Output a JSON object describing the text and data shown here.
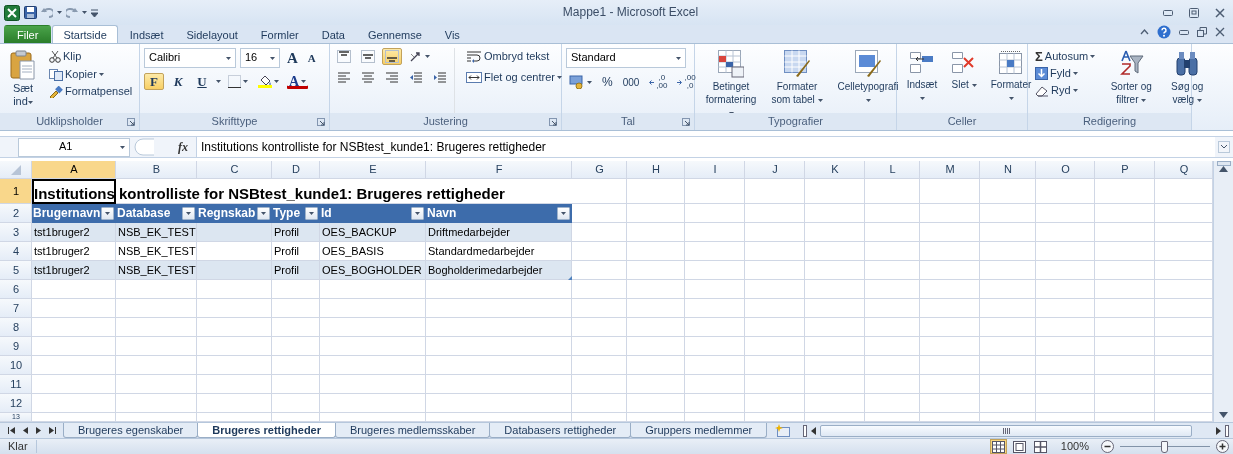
{
  "window": {
    "title": "Mappe1 - Microsoft Excel"
  },
  "ribbon_tabs": [
    {
      "label": "Filer",
      "kind": "file",
      "selected": false
    },
    {
      "label": "Startside",
      "kind": "tab",
      "selected": true
    },
    {
      "label": "Indsæt",
      "kind": "tab",
      "selected": false
    },
    {
      "label": "Sidelayout",
      "kind": "tab",
      "selected": false
    },
    {
      "label": "Formler",
      "kind": "tab",
      "selected": false
    },
    {
      "label": "Data",
      "kind": "tab",
      "selected": false
    },
    {
      "label": "Gennemse",
      "kind": "tab",
      "selected": false
    },
    {
      "label": "Vis",
      "kind": "tab",
      "selected": false
    }
  ],
  "clipboard": {
    "label": "Udklipsholder",
    "paste": "Sæt ind",
    "cut": "Klip",
    "copy": "Kopier",
    "format_painter": "Formatpensel"
  },
  "font": {
    "label": "Skrifttype",
    "font_name": "Calibri",
    "font_size": "16",
    "grow": "A",
    "shrink": "A",
    "bold": {
      "text": "F",
      "selected": true
    },
    "italic": {
      "text": "K",
      "selected": false
    },
    "underline": {
      "text": "U",
      "selected": false
    },
    "font_color": "A"
  },
  "alignment": {
    "label": "Justering",
    "vertical": [
      {
        "kind": "top",
        "selected": false
      },
      {
        "kind": "middle",
        "selected": false
      },
      {
        "kind": "bottom",
        "selected": true
      }
    ],
    "wrap_text": "Ombryd tekst",
    "merge": "Flet og centrer"
  },
  "number": {
    "label": "Tal",
    "format": "Standard",
    "percent": "%",
    "thousands": "000",
    "decimals": [
      {
        "top": ",0",
        "bottom": ",00"
      },
      {
        "top": ",00",
        "bottom": ",0"
      }
    ]
  },
  "styles": {
    "label": "Typografier",
    "conditional": "Betinget formatering",
    "as_table": "Formater som tabel",
    "cell_styles": "Celletypografi"
  },
  "cells": {
    "label": "Celler",
    "insert": "Indsæt",
    "delete": "Slet",
    "format": "Formater"
  },
  "editing": {
    "label": "Redigering",
    "autosum_symbol": "Σ",
    "autosum": "Autosum",
    "fill": "Fyld",
    "clear": "Ryd",
    "sort": "Sorter og filtrer",
    "find": "Søg og vælg"
  },
  "formula_bar": {
    "name_box": "A1",
    "fx": "fx",
    "formula": "Institutions kontrolliste for NSBtest_kunde1: Brugeres rettigheder"
  },
  "sheet": {
    "columns": [
      {
        "label": "A",
        "selected": true
      },
      {
        "label": "B",
        "selected": false
      },
      {
        "label": "C",
        "selected": false
      },
      {
        "label": "D",
        "selected": false
      },
      {
        "label": "E",
        "selected": false
      },
      {
        "label": "F",
        "selected": false
      },
      {
        "label": "G",
        "selected": false
      },
      {
        "label": "H",
        "selected": false
      },
      {
        "label": "I",
        "selected": false
      },
      {
        "label": "J",
        "selected": false
      },
      {
        "label": "K",
        "selected": false
      },
      {
        "label": "L",
        "selected": false
      },
      {
        "label": "M",
        "selected": false
      },
      {
        "label": "N",
        "selected": false
      },
      {
        "label": "O",
        "selected": false
      },
      {
        "label": "P",
        "selected": false
      },
      {
        "label": "Q",
        "selected": false
      }
    ],
    "rows": [
      {
        "label": "1",
        "selected": true
      },
      {
        "label": "2",
        "selected": false
      },
      {
        "label": "3",
        "selected": false
      },
      {
        "label": "4",
        "selected": false
      },
      {
        "label": "5",
        "selected": false
      },
      {
        "label": "6",
        "selected": false
      },
      {
        "label": "7",
        "selected": false
      },
      {
        "label": "8",
        "selected": false
      },
      {
        "label": "9",
        "selected": false
      },
      {
        "label": "10",
        "selected": false
      },
      {
        "label": "11",
        "selected": false
      },
      {
        "label": "12",
        "selected": false
      },
      {
        "label": "13",
        "selected": false
      }
    ],
    "title": "Institutions kontrolliste for NSBtest_kunde1: Brugeres rettigheder",
    "table": {
      "columns": [
        "Brugernavn",
        "Database",
        "Regnskab",
        "Type",
        "Id",
        "Navn"
      ],
      "rows": [
        [
          "tst1bruger2",
          "NSB_EK_TEST",
          null,
          "Profil",
          "OES_BACKUP",
          "Driftmedarbejder"
        ],
        [
          "tst1bruger2",
          "NSB_EK_TEST",
          null,
          "Profil",
          "OES_BASIS",
          "Standardmedarbejder"
        ],
        [
          "tst1bruger2",
          "NSB_EK_TEST",
          null,
          "Profil",
          "OES_BOGHOLDER",
          "Bogholderimedarbejder"
        ]
      ]
    }
  },
  "sheet_tabs": [
    {
      "label": "Brugeres egenskaber",
      "selected": false
    },
    {
      "label": "Brugeres rettigheder",
      "selected": true
    },
    {
      "label": "Brugeres medlemsskaber",
      "selected": false
    },
    {
      "label": "Databasers rettigheder",
      "selected": false
    },
    {
      "label": "Gruppers medlemmer",
      "selected": false
    }
  ],
  "status_bar": {
    "status": "Klar",
    "views": [
      {
        "kind": "normal",
        "selected": true
      },
      {
        "kind": "page_layout",
        "selected": false
      },
      {
        "kind": "page_break",
        "selected": false
      }
    ],
    "zoom": "100%",
    "zoom_slider": {
      "level": 0.5
    }
  }
}
